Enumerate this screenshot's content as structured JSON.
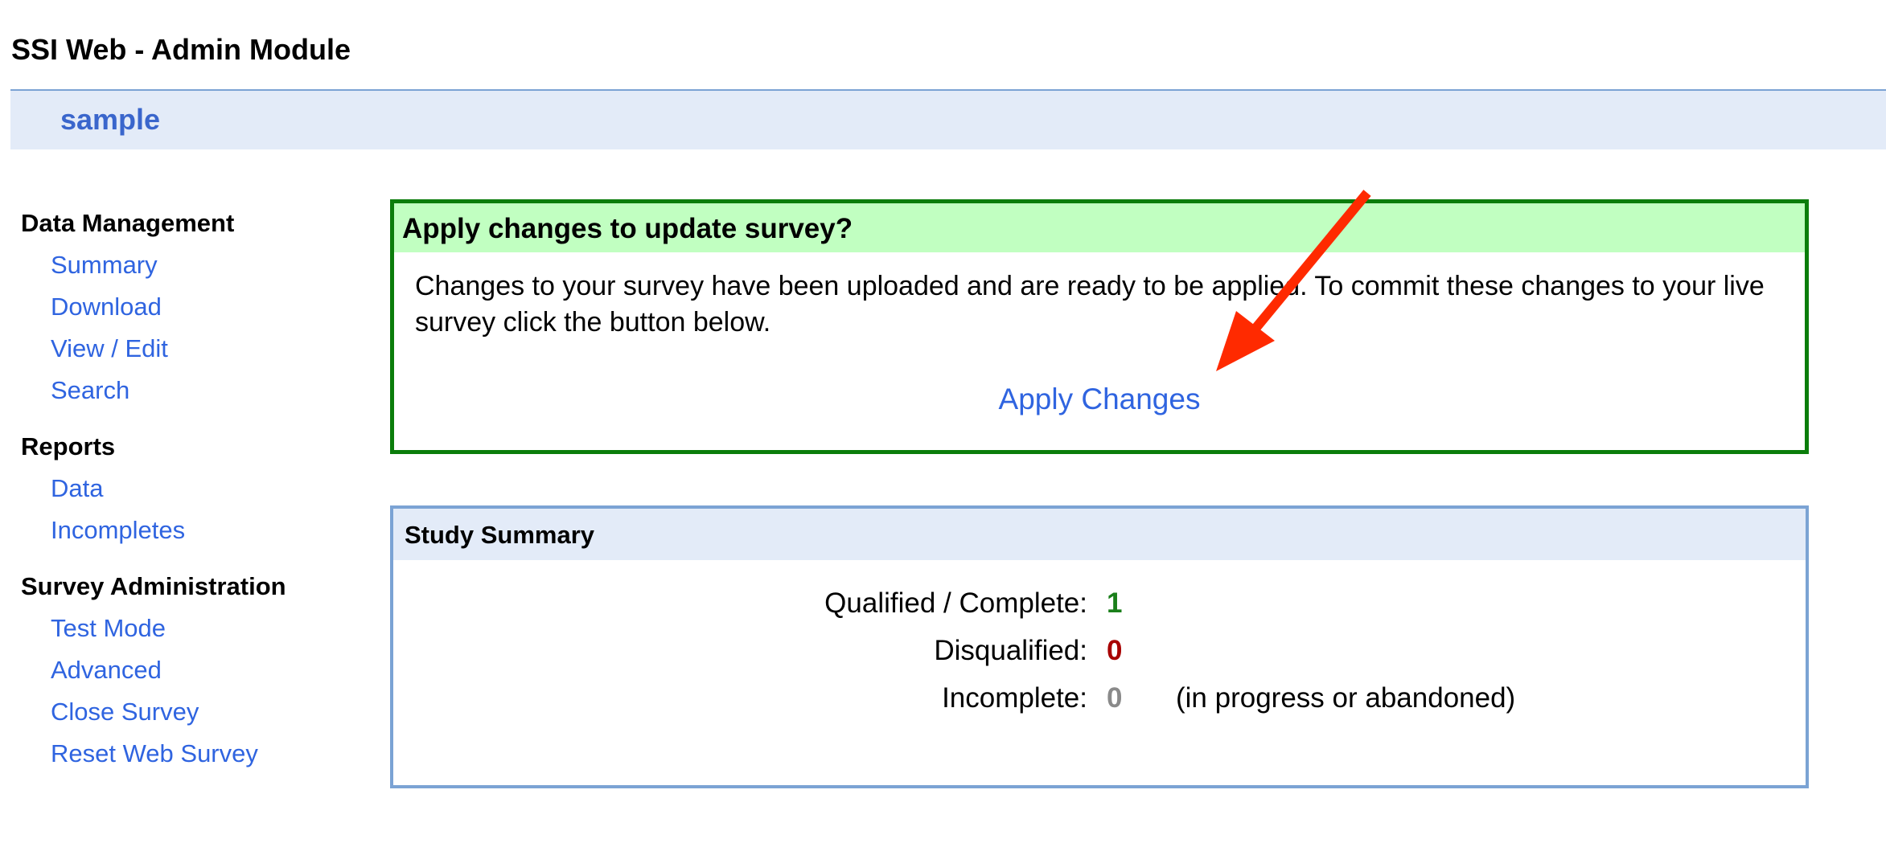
{
  "app": {
    "title": "SSI Web - Admin Module"
  },
  "study": {
    "name": "sample"
  },
  "sidebar": {
    "sections": [
      {
        "heading": "Data Management",
        "items": [
          {
            "label": "Summary"
          },
          {
            "label": "Download"
          },
          {
            "label": "View / Edit"
          },
          {
            "label": "Search"
          }
        ]
      },
      {
        "heading": "Reports",
        "items": [
          {
            "label": "Data"
          },
          {
            "label": "Incompletes"
          }
        ]
      },
      {
        "heading": "Survey Administration",
        "items": [
          {
            "label": "Test Mode"
          },
          {
            "label": "Advanced"
          },
          {
            "label": "Close Survey"
          },
          {
            "label": "Reset Web Survey"
          }
        ]
      }
    ]
  },
  "apply_panel": {
    "title": "Apply changes to update survey?",
    "message": "Changes to your survey have been uploaded and are ready to be applied. To commit these changes to your live survey click the button below.",
    "button_label": "Apply Changes"
  },
  "summary_panel": {
    "title": "Study Summary",
    "rows": [
      {
        "label": "Qualified / Complete:",
        "value": "1",
        "note": ""
      },
      {
        "label": "Disqualified:",
        "value": "0",
        "note": ""
      },
      {
        "label": "Incomplete:",
        "value": "0",
        "note": "(in progress or abandoned)"
      }
    ]
  },
  "colors": {
    "link": "#2f64e0",
    "study_name": "#3a66cc",
    "apply_border": "#0b7d0b",
    "apply_header_bg": "#c1ffc1",
    "summary_border": "#7ba3d4",
    "summary_header_bg": "#e3ebf8",
    "qualified_value": "#1a7f1a",
    "disqualified_value": "#a80000",
    "incomplete_value": "#8a8a8a",
    "annotation_arrow": "#ff2a00"
  },
  "annotation": {
    "icon": "arrow-pointer-icon",
    "target": "Apply Changes"
  }
}
